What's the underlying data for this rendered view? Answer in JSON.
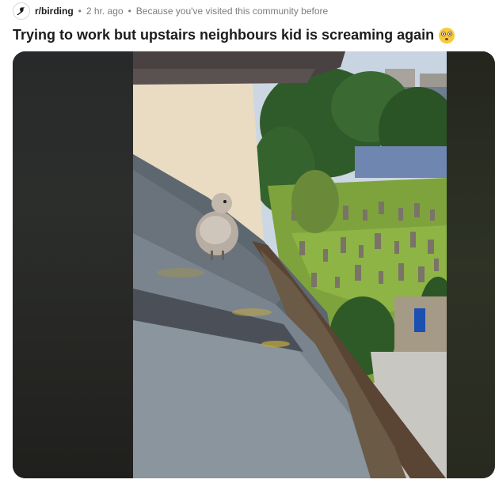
{
  "post": {
    "subreddit": "r/birding",
    "time": "2 hr. ago",
    "recommendation_reason": "Because you've visited this community before",
    "title": "Trying to work but upstairs neighbours kid is screaming again",
    "title_emoji": "flushed-face-emoji"
  },
  "media": {
    "description_icon": "gull-chick-on-roof-photo"
  },
  "colors": {
    "text": "#1c1c1c",
    "meta": "#7c7c7c",
    "media_bg": "#1d1e1a"
  }
}
